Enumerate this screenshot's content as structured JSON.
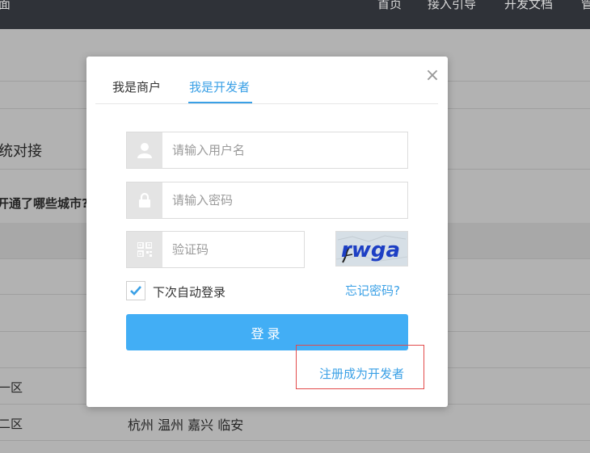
{
  "topbar": {
    "logo_fragment": "面",
    "nav": [
      "首页",
      "接入引导",
      "开发文档",
      "管"
    ]
  },
  "background": {
    "section_heading": "统对接",
    "question": "开通了哪些城市?",
    "rows": [
      {
        "region": "一区",
        "cities": ""
      },
      {
        "region": "二区",
        "cities": "杭州 温州 嘉兴 临安"
      }
    ]
  },
  "modal": {
    "close_symbol": "×",
    "tabs": [
      {
        "label": "我是商户",
        "active": false
      },
      {
        "label": "我是开发者",
        "active": true
      }
    ],
    "username": {
      "value": "",
      "placeholder": "请输入用户名",
      "icon": "user-icon"
    },
    "password": {
      "value": "",
      "placeholder": "请输入密码",
      "icon": "lock-icon"
    },
    "captcha": {
      "value": "",
      "placeholder": "验证码",
      "icon": "qr-code-icon",
      "image_text": "rwga"
    },
    "remember": {
      "label": "下次自动登录",
      "checked": true
    },
    "forgot_label": "忘记密码?",
    "login_label": "登录",
    "register_label": "注册成为开发者"
  },
  "colors": {
    "accent": "#3aa0e6",
    "button": "#42aef5",
    "highlight_box": "#e24a4a",
    "topbar": "#2f3238"
  }
}
